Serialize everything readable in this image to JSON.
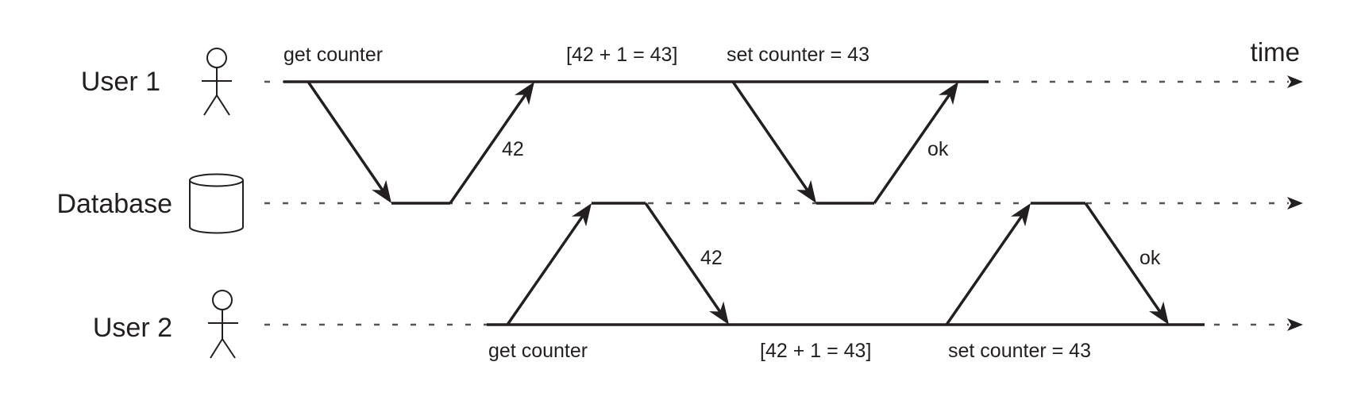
{
  "diagram": {
    "time_label": "time",
    "actors": [
      {
        "id": "user1",
        "label": "User 1",
        "icon": "person-icon"
      },
      {
        "id": "database",
        "label": "Database",
        "icon": "database-cylinder-icon"
      },
      {
        "id": "user2",
        "label": "User 2",
        "icon": "person-icon"
      }
    ],
    "annotations": {
      "user1": [
        "get counter",
        "[42 + 1 = 43]",
        "set counter = 43"
      ],
      "user2": [
        "get counter",
        "[42 + 1 = 43]",
        "set counter = 43"
      ]
    },
    "messages": [
      {
        "from": "user1",
        "to": "database",
        "label": ""
      },
      {
        "from": "database",
        "to": "user1",
        "label": "42"
      },
      {
        "from": "user1",
        "to": "database",
        "label": ""
      },
      {
        "from": "database",
        "to": "user1",
        "label": "ok"
      },
      {
        "from": "user2",
        "to": "database",
        "label": ""
      },
      {
        "from": "database",
        "to": "user2",
        "label": "42"
      },
      {
        "from": "user2",
        "to": "database",
        "label": ""
      },
      {
        "from": "database",
        "to": "user2",
        "label": "ok"
      }
    ]
  }
}
